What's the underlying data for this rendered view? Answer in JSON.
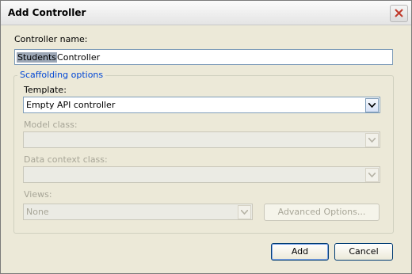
{
  "window": {
    "title": "Add Controller"
  },
  "controller_name": {
    "label": "Controller name:",
    "value_selected": "Students",
    "value_rest": "Controller"
  },
  "scaffolding": {
    "group_title": "Scaffolding options",
    "template_label": "Template:",
    "template_value": "Empty API controller",
    "model_class_label": "Model class:",
    "model_class_value": "",
    "data_context_label": "Data context class:",
    "data_context_value": "",
    "views_label": "Views:",
    "views_value": "None",
    "advanced_options_label": "Advanced Options..."
  },
  "buttons": {
    "add": "Add",
    "cancel": "Cancel"
  },
  "colors": {
    "accent": "#0046d5",
    "disabled_text": "#a7a597",
    "close_x": "#c0392b"
  }
}
